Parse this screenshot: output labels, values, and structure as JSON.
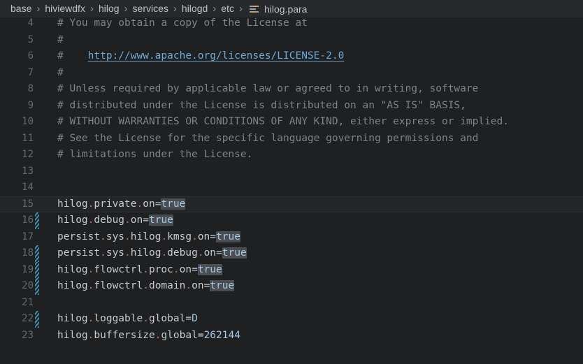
{
  "breadcrumb": {
    "items": [
      {
        "label": "base"
      },
      {
        "label": "hiviewdfx"
      },
      {
        "label": "hilog"
      },
      {
        "label": "services"
      },
      {
        "label": "hilogd"
      },
      {
        "label": "etc"
      }
    ],
    "separator": "›",
    "file": {
      "label": "hilog.para",
      "icon": "properties-file-icon"
    }
  },
  "colors": {
    "editor_background": "#1f2022",
    "breadcrumb_background": "#26282b",
    "line_number": "#636a72",
    "comment": "#7f8387",
    "link": "#6fa8d4",
    "value": "#a7c6e0",
    "punctuation": "#c0705a",
    "search_highlight": "#4b4f54",
    "change_marker": "#3d92b4",
    "current_line_background": "#232528"
  },
  "editor": {
    "language": "properties",
    "file_name": "hilog.para",
    "first_visible_line": 4,
    "last_visible_line": 23,
    "lines": [
      {
        "number": "4",
        "changed": false,
        "current": false,
        "clipped": true,
        "text": "# You may obtain a copy of the License at",
        "tokens": [
          {
            "t": "# You may obtain a copy of the License at",
            "c": "cmt"
          }
        ]
      },
      {
        "number": "5",
        "changed": false,
        "current": false,
        "text": "#",
        "tokens": [
          {
            "t": "#",
            "c": "cmt"
          }
        ]
      },
      {
        "number": "6",
        "changed": false,
        "current": false,
        "text": "#    http://www.apache.org/licenses/LICENSE-2.0",
        "tokens": [
          {
            "t": "#    ",
            "c": "cmt"
          },
          {
            "t": "http://www.apache.org/licenses/LICENSE-2.0",
            "c": "link"
          }
        ]
      },
      {
        "number": "7",
        "changed": false,
        "current": false,
        "text": "#",
        "tokens": [
          {
            "t": "#",
            "c": "cmt"
          }
        ]
      },
      {
        "number": "8",
        "changed": false,
        "current": false,
        "text": "# Unless required by applicable law or agreed to in writing, software",
        "tokens": [
          {
            "t": "# Unless required by applicable law or agreed to in writing, software",
            "c": "cmt"
          }
        ]
      },
      {
        "number": "9",
        "changed": false,
        "current": false,
        "text": "# distributed under the License is distributed on an \"AS IS\" BASIS,",
        "tokens": [
          {
            "t": "# distributed under the License is distributed on an \"AS IS\" BASIS,",
            "c": "cmt"
          }
        ]
      },
      {
        "number": "10",
        "changed": false,
        "current": false,
        "text": "# WITHOUT WARRANTIES OR CONDITIONS OF ANY KIND, either express or implied.",
        "tokens": [
          {
            "t": "# WITHOUT WARRANTIES OR CONDITIONS OF ANY KIND, either express or implied.",
            "c": "cmt"
          }
        ]
      },
      {
        "number": "11",
        "changed": false,
        "current": false,
        "text": "# See the License for the specific language governing permissions and",
        "tokens": [
          {
            "t": "# See the License for the specific language governing permissions and",
            "c": "cmt"
          }
        ]
      },
      {
        "number": "12",
        "changed": false,
        "current": false,
        "text": "# limitations under the License.",
        "tokens": [
          {
            "t": "# limitations under the License.",
            "c": "cmt"
          }
        ]
      },
      {
        "number": "13",
        "changed": false,
        "current": false,
        "text": "",
        "tokens": []
      },
      {
        "number": "14",
        "changed": false,
        "current": false,
        "text": "",
        "tokens": []
      },
      {
        "number": "15",
        "changed": false,
        "current": true,
        "text": "hilog.private.on=true",
        "tokens": [
          {
            "t": "hilog",
            "c": "key"
          },
          {
            "t": ".",
            "c": "dot"
          },
          {
            "t": "private",
            "c": "key"
          },
          {
            "t": ".",
            "c": "dot"
          },
          {
            "t": "on",
            "c": "key"
          },
          {
            "t": "=",
            "c": "eq"
          },
          {
            "t": "true",
            "c": "val",
            "hl": true
          }
        ]
      },
      {
        "number": "16",
        "changed": true,
        "current": false,
        "text": "hilog.debug.on=true",
        "tokens": [
          {
            "t": "hilog",
            "c": "key"
          },
          {
            "t": ".",
            "c": "dot"
          },
          {
            "t": "debug",
            "c": "key"
          },
          {
            "t": ".",
            "c": "dot"
          },
          {
            "t": "on",
            "c": "key"
          },
          {
            "t": "=",
            "c": "eq"
          },
          {
            "t": "true",
            "c": "val",
            "hl": true
          }
        ]
      },
      {
        "number": "17",
        "changed": false,
        "current": false,
        "text": "persist.sys.hilog.kmsg.on=true",
        "tokens": [
          {
            "t": "persist",
            "c": "key"
          },
          {
            "t": ".",
            "c": "dot"
          },
          {
            "t": "sys",
            "c": "key"
          },
          {
            "t": ".",
            "c": "dot"
          },
          {
            "t": "hilog",
            "c": "key"
          },
          {
            "t": ".",
            "c": "dot"
          },
          {
            "t": "kmsg",
            "c": "key"
          },
          {
            "t": ".",
            "c": "dot"
          },
          {
            "t": "on",
            "c": "key"
          },
          {
            "t": "=",
            "c": "eq"
          },
          {
            "t": "true",
            "c": "val",
            "hl": true
          }
        ]
      },
      {
        "number": "18",
        "changed": true,
        "current": false,
        "text": "persist.sys.hilog.debug.on=true",
        "tokens": [
          {
            "t": "persist",
            "c": "key"
          },
          {
            "t": ".",
            "c": "dot"
          },
          {
            "t": "sys",
            "c": "key"
          },
          {
            "t": ".",
            "c": "dot"
          },
          {
            "t": "hilog",
            "c": "key"
          },
          {
            "t": ".",
            "c": "dot"
          },
          {
            "t": "debug",
            "c": "key"
          },
          {
            "t": ".",
            "c": "dot"
          },
          {
            "t": "on",
            "c": "key"
          },
          {
            "t": "=",
            "c": "eq"
          },
          {
            "t": "true",
            "c": "val",
            "hl": true
          }
        ]
      },
      {
        "number": "19",
        "changed": true,
        "current": false,
        "text": "hilog.flowctrl.proc.on=true",
        "tokens": [
          {
            "t": "hilog",
            "c": "key"
          },
          {
            "t": ".",
            "c": "dot"
          },
          {
            "t": "flowctrl",
            "c": "key"
          },
          {
            "t": ".",
            "c": "dot"
          },
          {
            "t": "proc",
            "c": "key"
          },
          {
            "t": ".",
            "c": "dot"
          },
          {
            "t": "on",
            "c": "key"
          },
          {
            "t": "=",
            "c": "eq"
          },
          {
            "t": "true",
            "c": "val",
            "hl": true
          }
        ]
      },
      {
        "number": "20",
        "changed": true,
        "current": false,
        "text": "hilog.flowctrl.domain.on=true",
        "tokens": [
          {
            "t": "hilog",
            "c": "key"
          },
          {
            "t": ".",
            "c": "dot"
          },
          {
            "t": "flowctrl",
            "c": "key"
          },
          {
            "t": ".",
            "c": "dot"
          },
          {
            "t": "domain",
            "c": "key"
          },
          {
            "t": ".",
            "c": "dot"
          },
          {
            "t": "on",
            "c": "key"
          },
          {
            "t": "=",
            "c": "eq"
          },
          {
            "t": "true",
            "c": "val",
            "hl": true
          }
        ]
      },
      {
        "number": "21",
        "changed": false,
        "current": false,
        "text": "",
        "tokens": []
      },
      {
        "number": "22",
        "changed": true,
        "current": false,
        "text": "hilog.loggable.global=D",
        "tokens": [
          {
            "t": "hilog",
            "c": "key"
          },
          {
            "t": ".",
            "c": "dot"
          },
          {
            "t": "loggable",
            "c": "key"
          },
          {
            "t": ".",
            "c": "dot"
          },
          {
            "t": "global",
            "c": "key"
          },
          {
            "t": "=",
            "c": "eq"
          },
          {
            "t": "D",
            "c": "val"
          }
        ]
      },
      {
        "number": "23",
        "changed": false,
        "current": false,
        "text": "hilog.buffersize.global=262144",
        "tokens": [
          {
            "t": "hilog",
            "c": "key"
          },
          {
            "t": ".",
            "c": "dot"
          },
          {
            "t": "buffersize",
            "c": "key"
          },
          {
            "t": ".",
            "c": "dot"
          },
          {
            "t": "global",
            "c": "key"
          },
          {
            "t": "=",
            "c": "eq"
          },
          {
            "t": "262144",
            "c": "num"
          }
        ]
      }
    ]
  }
}
